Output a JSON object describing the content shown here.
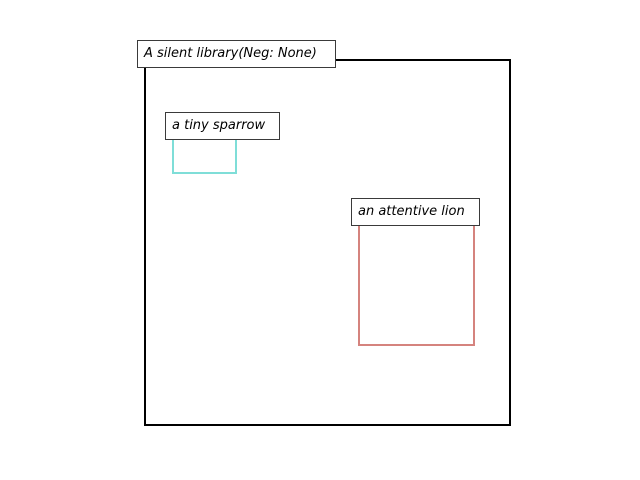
{
  "scene": {
    "title": "A silent library(Neg: None)",
    "objects": [
      {
        "label": "a tiny sparrow",
        "color": "#7fded8"
      },
      {
        "label": "an attentive lion",
        "color": "#d5837e"
      }
    ],
    "frame_color": "#000000"
  }
}
